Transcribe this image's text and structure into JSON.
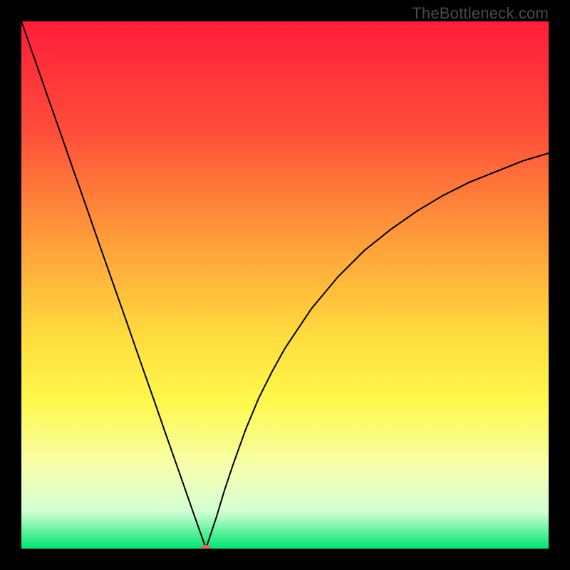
{
  "watermark": "TheBottleneck.com",
  "chart_data": {
    "type": "line",
    "title": "",
    "xlabel": "",
    "ylabel": "",
    "xlim": [
      0,
      100
    ],
    "ylim": [
      0,
      100
    ],
    "background_gradient": {
      "stops": [
        {
          "offset": 0.0,
          "color": "#ff1d3a"
        },
        {
          "offset": 0.2,
          "color": "#ff4b3a"
        },
        {
          "offset": 0.4,
          "color": "#ff983a"
        },
        {
          "offset": 0.6,
          "color": "#ffdd3e"
        },
        {
          "offset": 0.72,
          "color": "#fff84c"
        },
        {
          "offset": 0.85,
          "color": "#f6ffb0"
        },
        {
          "offset": 0.93,
          "color": "#d2ffd4"
        },
        {
          "offset": 0.965,
          "color": "#67f2a1"
        },
        {
          "offset": 1.0,
          "color": "#00e472"
        }
      ]
    },
    "series": [
      {
        "name": "bottleneck-curve",
        "color": "#000000",
        "stroke_width": 2,
        "x": [
          0.0,
          2.5,
          5.0,
          7.5,
          10.0,
          12.5,
          15.0,
          17.5,
          20.0,
          22.5,
          25.0,
          27.5,
          30.0,
          31.5,
          33.0,
          34.0,
          34.7,
          35.0,
          35.3,
          36.0,
          37.0,
          38.5,
          40.0,
          42.5,
          45.0,
          47.5,
          50.0,
          55.0,
          60.0,
          65.0,
          70.0,
          75.0,
          80.0,
          85.0,
          90.0,
          95.0,
          100.0
        ],
        "y": [
          100.0,
          92.9,
          85.7,
          78.6,
          71.4,
          64.3,
          57.1,
          50.0,
          42.9,
          35.7,
          28.6,
          21.4,
          14.3,
          10.0,
          5.7,
          2.9,
          0.9,
          0.0,
          0.9,
          3.0,
          6.0,
          11.0,
          15.5,
          22.5,
          28.5,
          33.5,
          38.0,
          45.5,
          51.5,
          56.5,
          60.5,
          64.0,
          67.0,
          69.5,
          71.5,
          73.5,
          75.0
        ]
      }
    ],
    "marker": {
      "name": "optimal-point",
      "x": 35.0,
      "y": 0.0,
      "color": "#d46a6a",
      "rx": 8,
      "ry": 5
    }
  }
}
